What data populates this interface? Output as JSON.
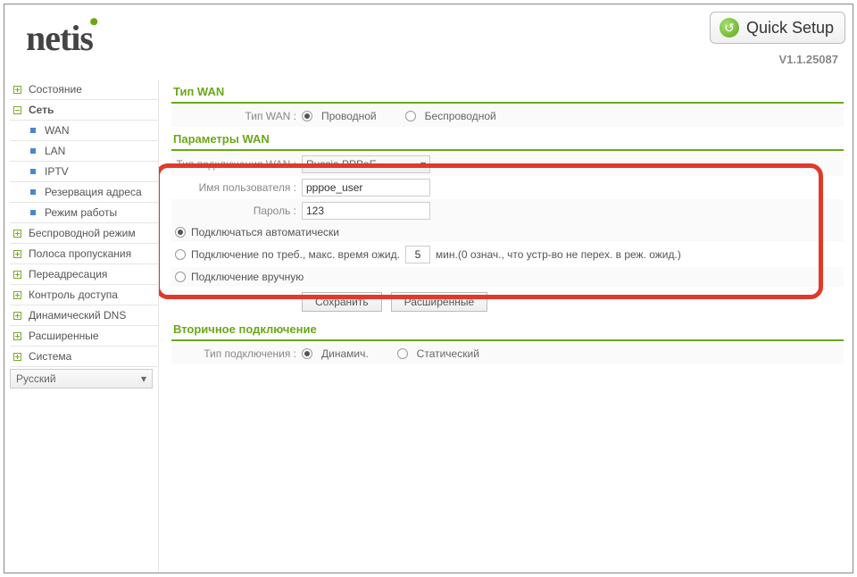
{
  "brand": "netis",
  "quick_setup_label": "Quick Setup",
  "version": "V1.1.25087",
  "sidebar": {
    "items": [
      {
        "label": "Состояние",
        "icon": "plus"
      },
      {
        "label": "Сеть",
        "icon": "minus",
        "active": true
      },
      {
        "label": "Беспроводной режим",
        "icon": "plus"
      },
      {
        "label": "Полоса пропускания",
        "icon": "plus"
      },
      {
        "label": "Переадресация",
        "icon": "plus"
      },
      {
        "label": "Контроль доступа",
        "icon": "plus"
      },
      {
        "label": "Динамический DNS",
        "icon": "plus"
      },
      {
        "label": "Расширенные",
        "icon": "plus"
      },
      {
        "label": "Система",
        "icon": "plus"
      }
    ],
    "subitems": [
      {
        "label": "WAN"
      },
      {
        "label": "LAN"
      },
      {
        "label": "IPTV"
      },
      {
        "label": "Резервация адреса"
      },
      {
        "label": "Режим работы"
      }
    ],
    "language": "Русский"
  },
  "sections": {
    "wan_type": {
      "title": "Тип WAN",
      "label": "Тип WAN :",
      "options": {
        "wired": "Проводной",
        "wireless": "Беспроводной"
      },
      "value": "wired"
    },
    "wan_params": {
      "title": "Параметры WAN",
      "conn_type_label": "Тип подключения WAN :",
      "conn_type_value": "Russia PPPoE",
      "user_label": "Имя пользователя :",
      "user_value": "pppoe_user",
      "pass_label": "Пароль :",
      "pass_value": "123",
      "mode_auto": "Подключаться автоматически",
      "mode_demand_pre": "Подключение по треб., макс. время ожид.",
      "mode_demand_value": "5",
      "mode_demand_post": "мин.(0 означ., что устр-во не перех. в реж. ожид.)",
      "mode_manual": "Подключение вручную",
      "mode_value": "auto",
      "save_btn": "Сохранить",
      "advanced_btn": "Расширенные"
    },
    "secondary": {
      "title": "Вторичное подключение",
      "label": "Тип подключения :",
      "options": {
        "dyn": "Динамич.",
        "stat": "Статический"
      },
      "value": "dyn"
    }
  }
}
